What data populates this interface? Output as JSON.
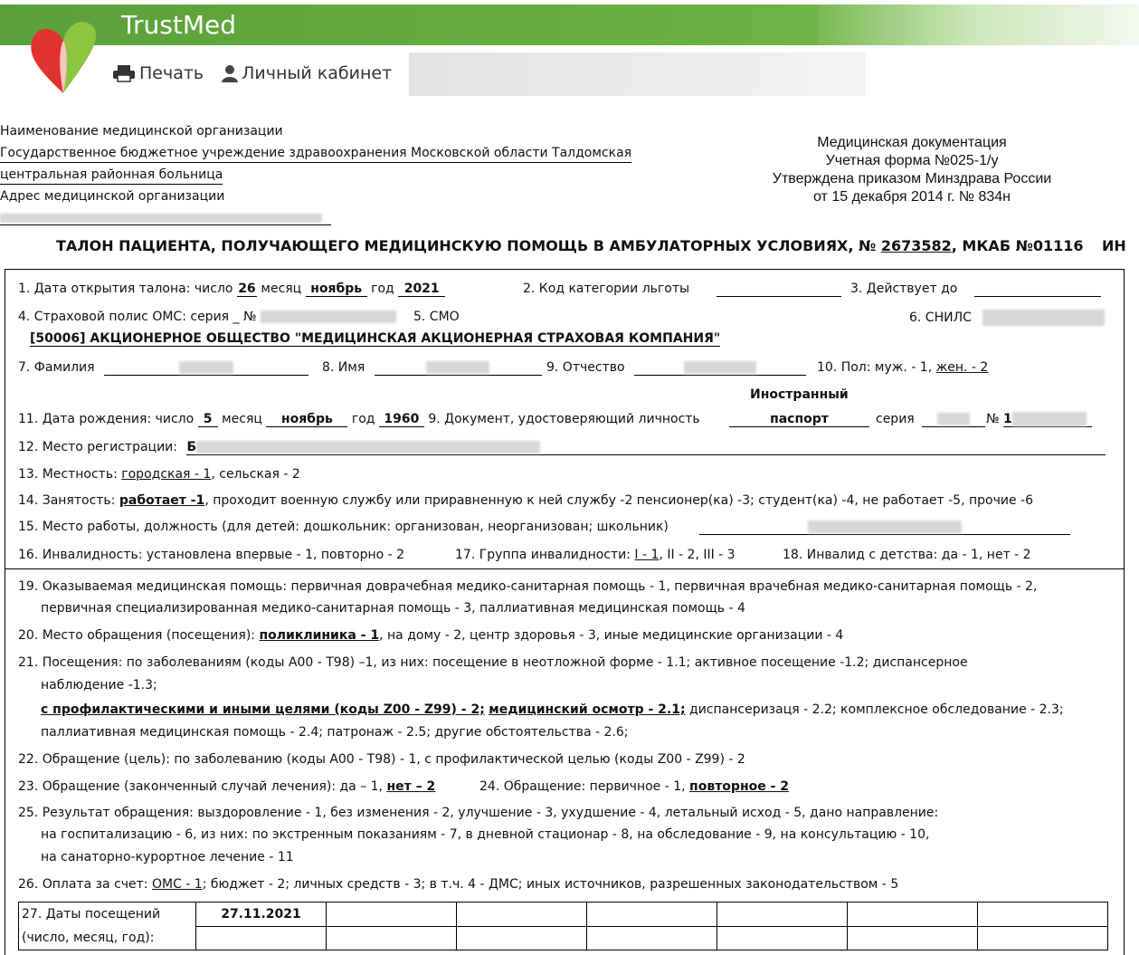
{
  "header": {
    "brand": "TrustMed",
    "print_label": "Печать",
    "cabinet_label": "Личный кабинет"
  },
  "org": {
    "name_label": "Наименование медицинской организации",
    "name_line1": "Государственное бюджетное учреждение здравоохранения Московской области Талдомская",
    "name_line2": "центральная районная больница",
    "address_label": "Адрес медицинской организации"
  },
  "med_doc": {
    "line1": "Медицинская документация",
    "line2": "Учетная форма №025-1/у",
    "line3": "Утверждена приказом Минздрава России",
    "line4": "от 15 декабря 2014 г. № 834н"
  },
  "title": {
    "prefix": "ТАЛОН ПАЦИЕНТА, ПОЛУЧАЮЩЕГО МЕДИЦИНСКУЮ ПОМОЩЬ В АМБУЛАТОРНЫХ УСЛОВИЯХ, №",
    "number": "2673582",
    "mkab": ", МКАБ №01116",
    "in": "ИН"
  },
  "f1": {
    "label": "1. Дата открытия талона: число",
    "day": "26",
    "month_label": "месяц",
    "month": "ноябрь",
    "year_label": "год",
    "year": "2021"
  },
  "f2": {
    "label": "2. Код категории льготы"
  },
  "f3": {
    "label": "3. Действует до"
  },
  "f4": {
    "label": "4. Страховой полис ОМС: серия",
    "num_label": "№"
  },
  "f5": {
    "label": "5. СМО",
    "value": "[50006] АКЦИОНЕРНОЕ ОБЩЕСТВО \"МЕДИЦИНСКАЯ АКЦИОНЕРНАЯ СТРАХОВАЯ КОМПАНИЯ\""
  },
  "f6": {
    "label": "6. СНИЛС"
  },
  "f7": {
    "label": "7. Фамилия"
  },
  "f8": {
    "label": "8. Имя"
  },
  "f9": {
    "label": "9. Отчество"
  },
  "f10": {
    "label": "10. Пол: муж. - 1,",
    "female": "жен. - 2"
  },
  "f11": {
    "label": "11. Дата рождения: число",
    "day": "5",
    "month_label": "месяц",
    "month": "ноябрь",
    "year_label": "год",
    "year": "1960"
  },
  "doc": {
    "label": "9. Документ, удостоверяющий личность",
    "type_line1": "Иностранный",
    "type_line2": "паспорт",
    "series_label": "серия",
    "num_label": "№",
    "num_start": "1"
  },
  "f12": {
    "label": "12. Место регистрации:",
    "start": "Б"
  },
  "f13": {
    "label": "13. Местность:",
    "city": "городская - 1",
    "rest": ",  сельская - 2"
  },
  "f14": {
    "label": "14. Занятость:",
    "sel": "работает -1",
    "rest": ", проходит военную службу или приравненную к ней службу -2 пенсионер(ка) -3; студент(ка) -4, не работает -5, прочие -6"
  },
  "f15": {
    "label": "15. Место работы, должность (для детей: дошкольник: организован, неорганизован; школьник)"
  },
  "f16": {
    "label": "16. Инвалидность: установлена впервые - 1, повторно - 2"
  },
  "f17": {
    "label": "17. Группа инвалидности:",
    "sel": "I - 1",
    "rest": ", II - 2, III - 3"
  },
  "f18": {
    "label": "18. Инвалид с детства: да - 1, нет - 2"
  },
  "f19": {
    "line1": "19. Оказываемая медицинская помощь: первичная доврачебная медико-санитарная помощь - 1, первичная врачебная медико-санитарная помощь - 2,",
    "line2": "первичная специализированная медико-санитарная помощь - 3, паллиативная медицинская помощь - 4"
  },
  "f20": {
    "label": "20. Место обращения (посещения):",
    "sel": "поликлиника - 1",
    "rest": ",  на дому - 2,  центр здоровья - 3, иные медицинские организации - 4"
  },
  "f21": {
    "line1": "21. Посещения: по заболеваниям (коды А00 - Т98) –1,  из них: посещение в неотложной форме - 1.1; активное посещение -1.2;  диспансерное",
    "line2": "наблюдение -1.3;",
    "sel1": "с профилактическими и иными целями (коды Z00 - Z99) - 2;",
    "sel2": "медицинский осмотр - 2.1;",
    "rest3": " диспансеризаця - 2.2;  комплексное обследование - 2.3;",
    "line4": "паллиативная медицинская помощь - 2.4; патронаж - 2.5;  другие обстоятельства - 2.6;"
  },
  "f22": {
    "label": "22. Обращение (цель): по заболеванию (коды А00 - Т98) - 1,  с профилактической целью (коды Z00 - Z99) - 2"
  },
  "f23": {
    "label": "23. Обращение (законченный случай лечения): да – 1,",
    "sel": "нет – 2"
  },
  "f24": {
    "label": "24. Обращение: первичное - 1,",
    "sel": "повторное - 2"
  },
  "f25": {
    "line1": "25. Результат обращения: выздоровление - 1, без изменения - 2, улучшение - 3, ухудшение - 4, летальный исход - 5, дано направление:",
    "line2": "на госпитализацию - 6, из них: по экстренным показаниям - 7, в дневной стационар - 8, на обследование - 9, на консультацию - 10,",
    "line3": "на санаторно-курортное лечение - 11"
  },
  "f26": {
    "label": "26. Оплата за счет:",
    "sel": "ОМС - 1",
    "rest": "; бюджет - 2; личных средств - 3; в т.ч. 4 - ДМС; иных источников, разрешенных законодательством - 5"
  },
  "f27": {
    "label1": "27. Даты посещений",
    "label2": "(число, месяц, год):",
    "dates": [
      "27.11.2021",
      "",
      "",
      "",
      "",
      "",
      ""
    ]
  }
}
